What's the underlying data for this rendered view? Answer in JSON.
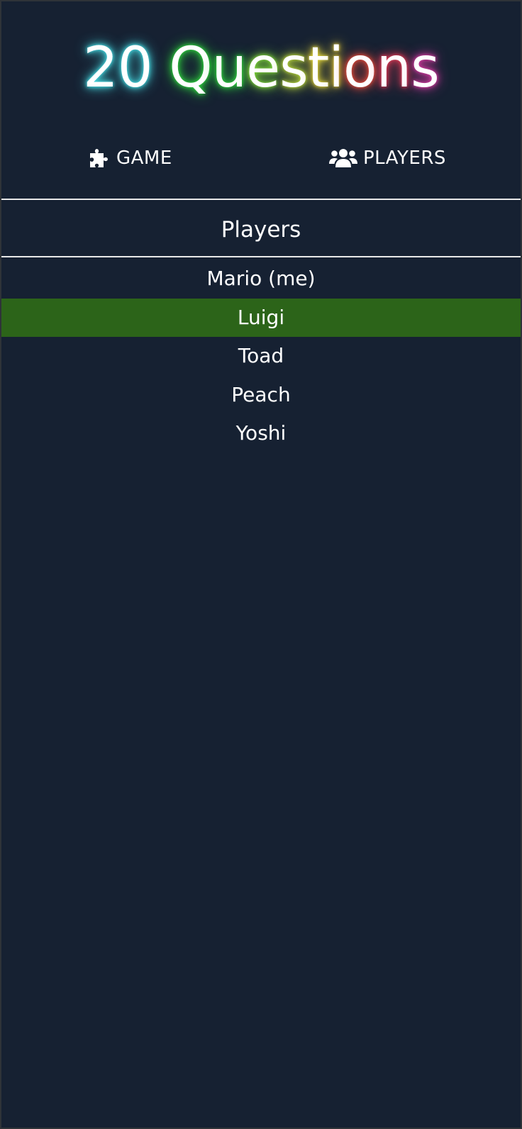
{
  "app": {
    "title": "20 Questions",
    "title_glow_colors": [
      "#46d9e0",
      "#46d9e0",
      "#2ecf3c",
      "#2ecf3c",
      "#7fd63a",
      "#b8d63a",
      "#e3d53a",
      "#e3c83a",
      "#e34a3a",
      "#e33a55",
      "#d63aa0",
      "#c83ad6"
    ],
    "background_color": "#162132",
    "selected_color": "#2c6419"
  },
  "nav": {
    "items": [
      {
        "label": "GAME",
        "icon": "puzzle-icon"
      },
      {
        "label": "PLAYERS",
        "icon": "users-icon"
      }
    ]
  },
  "players_section": {
    "heading": "Players",
    "players": [
      {
        "name": "Mario (me)",
        "selected": false
      },
      {
        "name": "Luigi",
        "selected": true
      },
      {
        "name": "Toad",
        "selected": false
      },
      {
        "name": "Peach",
        "selected": false
      },
      {
        "name": "Yoshi",
        "selected": false
      }
    ]
  }
}
